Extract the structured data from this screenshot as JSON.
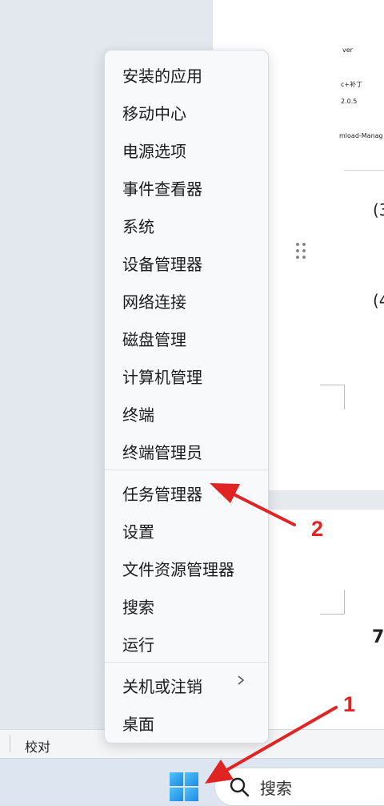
{
  "document": {
    "fragments": [
      "ver",
      "c+补丁",
      "2.0.5",
      "mload-Manag",
      "(3",
      "(4",
      "7"
    ]
  },
  "status_bar": {
    "label": "校对"
  },
  "taskbar": {
    "search_label": "搜索",
    "start_icon": "windows-logo"
  },
  "context_menu": {
    "items": [
      "安装的应用",
      "移动中心",
      "电源选项",
      "事件查看器",
      "系统",
      "设备管理器",
      "网络连接",
      "磁盘管理",
      "计算机管理",
      "终端",
      "终端管理员",
      "任务管理器",
      "设置",
      "文件资源管理器",
      "搜索",
      "运行",
      "关机或注销",
      "桌面"
    ]
  },
  "annotations": {
    "step1": "1",
    "step2": "2",
    "color": "#e02424"
  }
}
